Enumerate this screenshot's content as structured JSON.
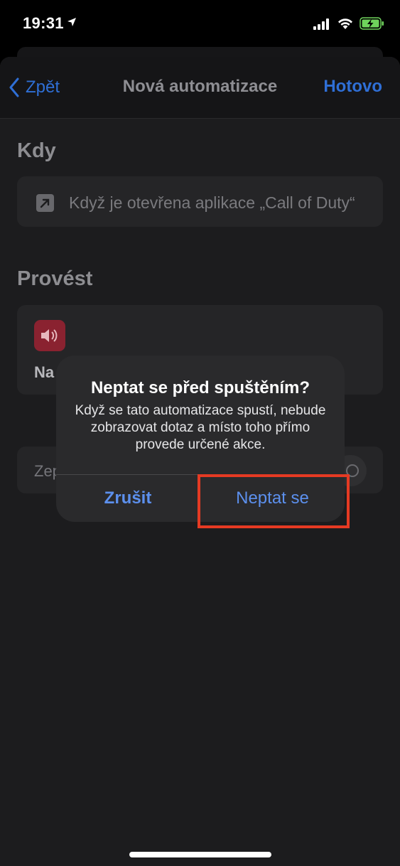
{
  "status_bar": {
    "time": "19:31",
    "icons": [
      "location-arrow-icon",
      "signal-icon",
      "wifi-icon",
      "battery-charging-icon"
    ]
  },
  "nav": {
    "back_label": "Zpět",
    "title": "Nová automatizace",
    "done_label": "Hotovo"
  },
  "when": {
    "heading": "Kdy",
    "trigger_text": "Když je otevřena aplikace „Call of Duty“",
    "icon": "open-app-arrow-icon"
  },
  "perform": {
    "heading": "Provést",
    "action_label": "Na",
    "icon": "speaker-volume-icon"
  },
  "ask_toggle": {
    "label": "Zep"
  },
  "alert": {
    "title": "Neptat se před spuštěním?",
    "message": "Když se tato automatizace spustí, nebude zobrazovat dotaz a místo toho přímo provede určené akce.",
    "cancel_label": "Zrušit",
    "confirm_label": "Neptat se"
  },
  "colors": {
    "accent": "#2f6fd6",
    "alert_button": "#5c90ee",
    "highlight": "#e53a23",
    "speaker_tile": "#8a2230"
  }
}
